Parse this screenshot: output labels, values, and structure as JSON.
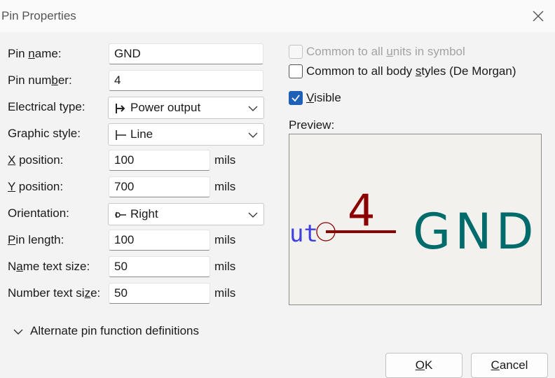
{
  "window": {
    "title": "Pin Properties"
  },
  "fields": [
    {
      "label": "Pin name:",
      "value": "GND"
    },
    {
      "label": "Pin number:",
      "value": "4"
    },
    {
      "label": "Electrical type:",
      "value": "Power output"
    },
    {
      "label": "Graphic style:",
      "value": "Line"
    },
    {
      "label": "X position:",
      "value": "100",
      "unit": "mils"
    },
    {
      "label": "Y position:",
      "value": "700",
      "unit": "mils"
    },
    {
      "label": "Orientation:",
      "value": "Right"
    },
    {
      "label": "Pin length:",
      "value": "100",
      "unit": "mils"
    },
    {
      "label": "Name text size:",
      "value": "50",
      "unit": "mils"
    },
    {
      "label": "Number text size:",
      "value": "50",
      "unit": "mils"
    }
  ],
  "options": {
    "common_units": {
      "label": "Common to all units in symbol",
      "checked": false,
      "enabled": false
    },
    "common_body": {
      "label": "Common to all body styles (De Morgan)",
      "checked": false,
      "enabled": true
    },
    "visible": {
      "label": "Visible",
      "checked": true,
      "enabled": true
    }
  },
  "preview": {
    "label": "Preview:",
    "pin_number": "4",
    "pin_name": "GND",
    "partial_label": "ut",
    "colors": {
      "pin": "#8b0000",
      "name": "#006b6b",
      "partial": "#4040e0",
      "background": "#f3f1ed"
    }
  },
  "alternate": {
    "label": "Alternate pin function definitions",
    "icon": "chevron-down-icon"
  },
  "buttons": {
    "ok": "OK",
    "cancel": "Cancel"
  },
  "colors": {
    "accent": "#1e5fb8",
    "dialog_bg": "#f3f3f3"
  }
}
